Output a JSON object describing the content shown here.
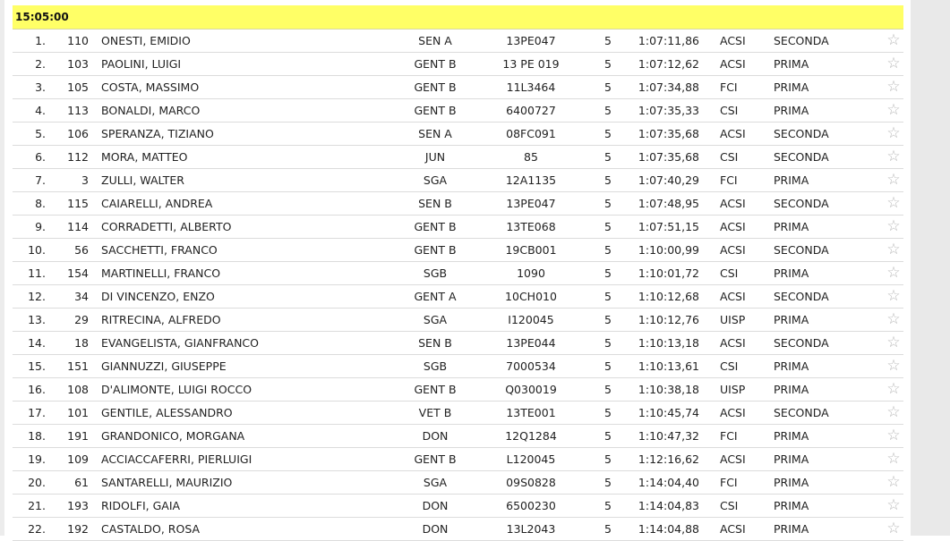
{
  "header": {
    "time": "15:05:00"
  },
  "fav_icon": "☆",
  "rows": [
    {
      "pos": "1.",
      "bib": "110",
      "name": "ONESTI, EMIDIO",
      "cat": "SEN A",
      "lic": "13PE047",
      "laps": "5",
      "time": "1:07:11,86",
      "ente": "ACSI",
      "group": "SECONDA"
    },
    {
      "pos": "2.",
      "bib": "103",
      "name": "PAOLINI, LUIGI",
      "cat": "GENT B",
      "lic": "13 PE 019",
      "laps": "5",
      "time": "1:07:12,62",
      "ente": "ACSI",
      "group": "PRIMA"
    },
    {
      "pos": "3.",
      "bib": "105",
      "name": "COSTA, MASSIMO",
      "cat": "GENT B",
      "lic": "11L3464",
      "laps": "5",
      "time": "1:07:34,88",
      "ente": "FCI",
      "group": "PRIMA"
    },
    {
      "pos": "4.",
      "bib": "113",
      "name": "BONALDI, MARCO",
      "cat": "GENT B",
      "lic": "6400727",
      "laps": "5",
      "time": "1:07:35,33",
      "ente": "CSI",
      "group": "PRIMA"
    },
    {
      "pos": "5.",
      "bib": "106",
      "name": "SPERANZA, TIZIANO",
      "cat": "SEN A",
      "lic": "08FC091",
      "laps": "5",
      "time": "1:07:35,68",
      "ente": "ACSI",
      "group": "SECONDA"
    },
    {
      "pos": "6.",
      "bib": "112",
      "name": "MORA, MATTEO",
      "cat": "JUN",
      "lic": "85",
      "laps": "5",
      "time": "1:07:35,68",
      "ente": "CSI",
      "group": "SECONDA"
    },
    {
      "pos": "7.",
      "bib": "3",
      "name": "ZULLI, WALTER",
      "cat": "SGA",
      "lic": "12A1135",
      "laps": "5",
      "time": "1:07:40,29",
      "ente": "FCI",
      "group": "PRIMA"
    },
    {
      "pos": "8.",
      "bib": "115",
      "name": "CAIARELLI, ANDREA",
      "cat": "SEN B",
      "lic": "13PE047",
      "laps": "5",
      "time": "1:07:48,95",
      "ente": "ACSI",
      "group": "SECONDA"
    },
    {
      "pos": "9.",
      "bib": "114",
      "name": "CORRADETTI, ALBERTO",
      "cat": "GENT B",
      "lic": "13TE068",
      "laps": "5",
      "time": "1:07:51,15",
      "ente": "ACSI",
      "group": "PRIMA"
    },
    {
      "pos": "10.",
      "bib": "56",
      "name": "SACCHETTI, FRANCO",
      "cat": "GENT B",
      "lic": "19CB001",
      "laps": "5",
      "time": "1:10:00,99",
      "ente": "ACSI",
      "group": "SECONDA"
    },
    {
      "pos": "11.",
      "bib": "154",
      "name": "MARTINELLI, FRANCO",
      "cat": "SGB",
      "lic": "1090",
      "laps": "5",
      "time": "1:10:01,72",
      "ente": "CSI",
      "group": "PRIMA"
    },
    {
      "pos": "12.",
      "bib": "34",
      "name": "DI VINCENZO, ENZO",
      "cat": "GENT A",
      "lic": "10CH010",
      "laps": "5",
      "time": "1:10:12,68",
      "ente": "ACSI",
      "group": "SECONDA"
    },
    {
      "pos": "13.",
      "bib": "29",
      "name": "RITRECINA, ALFREDO",
      "cat": "SGA",
      "lic": "I120045",
      "laps": "5",
      "time": "1:10:12,76",
      "ente": "UISP",
      "group": "PRIMA"
    },
    {
      "pos": "14.",
      "bib": "18",
      "name": "EVANGELISTA, GIANFRANCO",
      "cat": "SEN B",
      "lic": "13PE044",
      "laps": "5",
      "time": "1:10:13,18",
      "ente": "ACSI",
      "group": "SECONDA"
    },
    {
      "pos": "15.",
      "bib": "151",
      "name": "GIANNUZZI, GIUSEPPE",
      "cat": "SGB",
      "lic": "7000534",
      "laps": "5",
      "time": "1:10:13,61",
      "ente": "CSI",
      "group": "PRIMA"
    },
    {
      "pos": "16.",
      "bib": "108",
      "name": "D'ALIMONTE, LUIGI ROCCO",
      "cat": "GENT B",
      "lic": "Q030019",
      "laps": "5",
      "time": "1:10:38,18",
      "ente": "UISP",
      "group": "PRIMA"
    },
    {
      "pos": "17.",
      "bib": "101",
      "name": "GENTILE, ALESSANDRO",
      "cat": "VET B",
      "lic": "13TE001",
      "laps": "5",
      "time": "1:10:45,74",
      "ente": "ACSI",
      "group": "SECONDA"
    },
    {
      "pos": "18.",
      "bib": "191",
      "name": "GRANDONICO, MORGANA",
      "cat": "DON",
      "lic": "12Q1284",
      "laps": "5",
      "time": "1:10:47,32",
      "ente": "FCI",
      "group": "PRIMA"
    },
    {
      "pos": "19.",
      "bib": "109",
      "name": "ACCIACCAFERRI, PIERLUIGI",
      "cat": "GENT B",
      "lic": "L120045",
      "laps": "5",
      "time": "1:12:16,62",
      "ente": "ACSI",
      "group": "PRIMA"
    },
    {
      "pos": "20.",
      "bib": "61",
      "name": "SANTARELLI, MAURIZIO",
      "cat": "SGA",
      "lic": "09S0828",
      "laps": "5",
      "time": "1:14:04,40",
      "ente": "FCI",
      "group": "PRIMA"
    },
    {
      "pos": "21.",
      "bib": "193",
      "name": "RIDOLFI, GAIA",
      "cat": "DON",
      "lic": "6500230",
      "laps": "5",
      "time": "1:14:04,83",
      "ente": "CSI",
      "group": "PRIMA"
    },
    {
      "pos": "22.",
      "bib": "192",
      "name": "CASTALDO, ROSA",
      "cat": "DON",
      "lic": "13L2043",
      "laps": "5",
      "time": "1:14:04,88",
      "ente": "ACSI",
      "group": "PRIMA"
    }
  ]
}
